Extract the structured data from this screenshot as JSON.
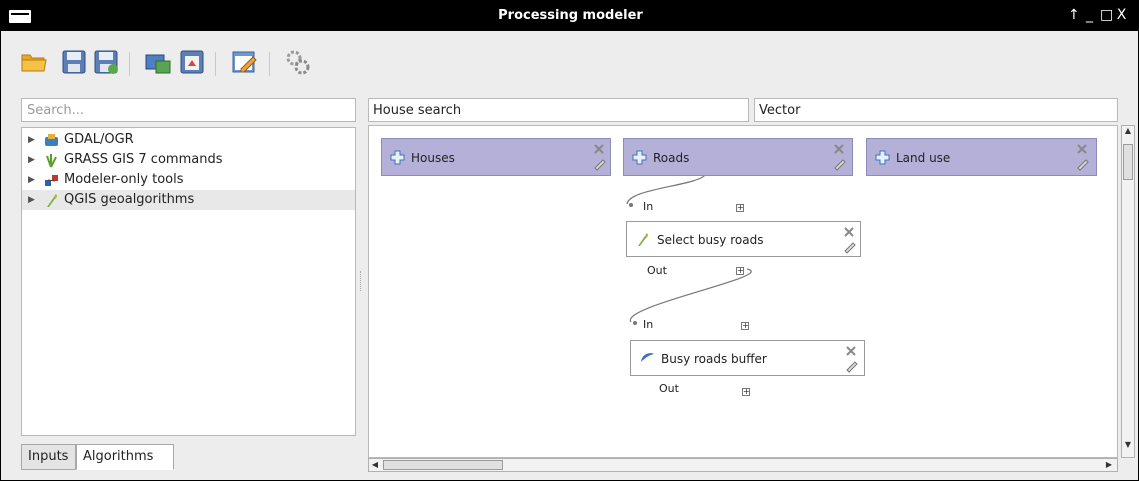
{
  "window": {
    "title": "Processing modeler",
    "controls": [
      "↑",
      "_",
      "□",
      "X"
    ]
  },
  "toolbar": {
    "buttons": [
      {
        "name": "open-model-button",
        "icon": "folder-open-icon"
      },
      {
        "name": "save-button",
        "icon": "save-icon"
      },
      {
        "name": "save-as-button",
        "icon": "save-as-icon"
      },
      {
        "name": "export-image-button",
        "icon": "export-image-icon"
      },
      {
        "name": "export-python-button",
        "icon": "export-script-icon"
      },
      {
        "name": "edit-help-button",
        "icon": "edit-help-icon"
      },
      {
        "name": "run-model-button",
        "icon": "gears-icon"
      }
    ]
  },
  "left_panel": {
    "search_placeholder": "Search...",
    "tree": [
      {
        "label": "GDAL/OGR",
        "icon": "gdal-icon",
        "color": "#3a7fc0"
      },
      {
        "label": "GRASS GIS 7 commands",
        "icon": "grass-icon",
        "color": "#5aa02c"
      },
      {
        "label": "Modeler-only tools",
        "icon": "modeler-icon",
        "color": "#c0392b"
      },
      {
        "label": "QGIS geoalgorithms",
        "icon": "qgis-icon",
        "color": "#7cb342"
      }
    ],
    "tabs": [
      {
        "label": "Inputs",
        "active": false
      },
      {
        "label": "Algorithms",
        "active": true
      }
    ]
  },
  "model": {
    "name": "House search",
    "group": "Vector"
  },
  "canvas": {
    "inputs": [
      {
        "label": "Houses"
      },
      {
        "label": "Roads"
      },
      {
        "label": "Land use"
      }
    ],
    "algorithms": [
      {
        "label": "Select busy roads",
        "in_label": "In",
        "out_label": "Out",
        "icon": "select-icon"
      },
      {
        "label": "Busy roads buffer",
        "in_label": "In",
        "out_label": "Out",
        "icon": "buffer-icon"
      }
    ]
  },
  "colors": {
    "input_fill": "#b4b0d8",
    "titlebar": "#000000",
    "accent_blue": "#3b6fc4"
  }
}
